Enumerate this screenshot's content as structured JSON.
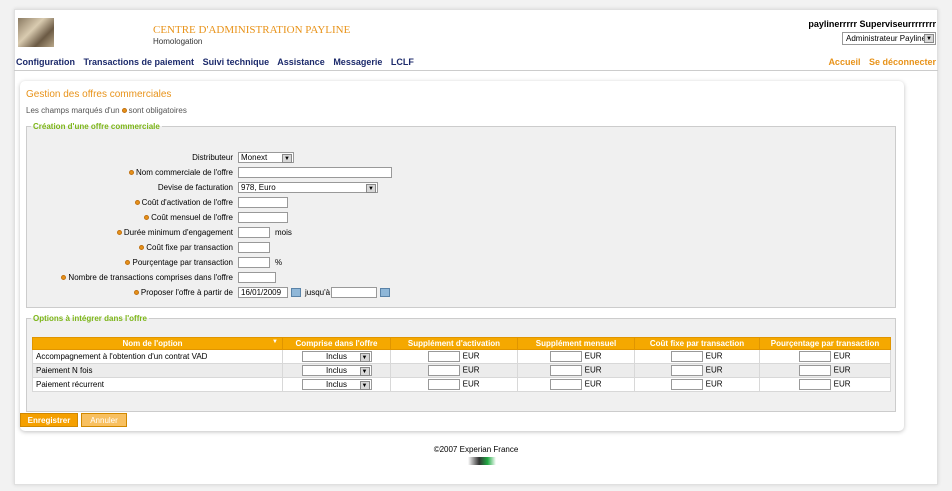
{
  "header": {
    "title": "CENTRE D'ADMINISTRATION PAYLINE",
    "subtitle": "Homologation",
    "user": "paylinerrrrr Superviseurrrrrrrr",
    "role": "Administrateur Payline"
  },
  "nav": {
    "items": [
      "Configuration",
      "Transactions de paiement",
      "Suivi technique",
      "Assistance",
      "Messagerie",
      "LCLF"
    ],
    "right": [
      "Accueil",
      "Se déconnecter"
    ]
  },
  "page": {
    "title": "Gestion des offres commerciales",
    "required_note_pre": "Les champs marqués d'un",
    "required_note_post": "sont obligatoires"
  },
  "form": {
    "legend": "Création d'une offre commerciale",
    "distributor_label": "Distributeur",
    "distributor_value": "Monext",
    "name_label": "Nom commerciale de l'offre",
    "currency_label": "Devise de facturation",
    "currency_value": "978, Euro",
    "activation_label": "Coût d'activation de l'offre",
    "monthly_label": "Coût mensuel de l'offre",
    "duration_label": "Durée minimum d'engagement",
    "duration_unit": "mois",
    "fixed_label": "Coût fixe par transaction",
    "percent_label": "Pourçentage par transaction",
    "percent_unit": "%",
    "count_label": "Nombre de transactions comprises dans l'offre",
    "start_label": "Proposer l'offre à partir de",
    "start_value": "16/01/2009",
    "until_label": "jusqu'à"
  },
  "options": {
    "legend": "Options à intégrer dans l'offre",
    "columns": [
      "Nom de l'option",
      "Comprise dans l'offre",
      "Supplément d'activation",
      "Supplément mensuel",
      "Coût fixe par transaction",
      "Pourçentage par transaction"
    ],
    "currency": "EUR",
    "rows": [
      {
        "name": "Accompagnement à l'obtention d'un contrat VAD",
        "included": "Inclus"
      },
      {
        "name": "Paiement N fois",
        "included": "Inclus"
      },
      {
        "name": "Paiement récurrent",
        "included": "Inclus"
      }
    ]
  },
  "buttons": {
    "save": "Enregistrer",
    "cancel": "Annuler"
  },
  "footer": {
    "copyright": "©2007 Experian France"
  },
  "colors": {
    "accent": "#e8931a",
    "nav": "#1c2a6b",
    "legend": "#7cb518",
    "table_header": "#f5a800"
  }
}
